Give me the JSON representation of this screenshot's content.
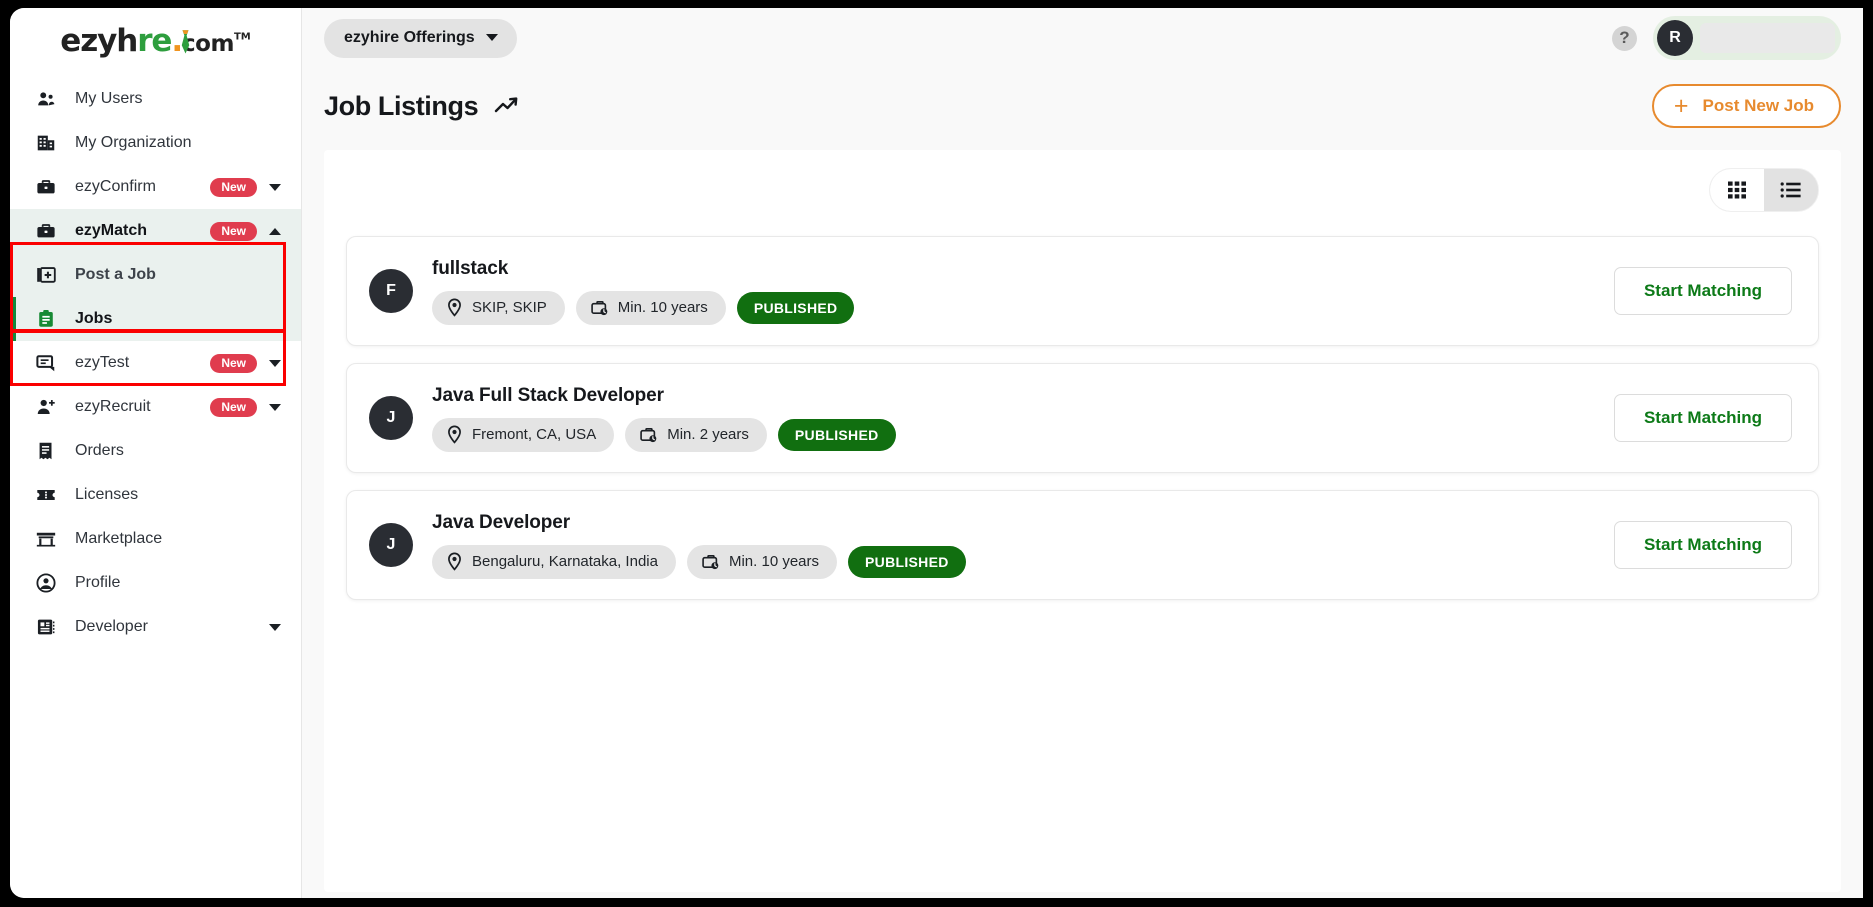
{
  "brand": {
    "logo_text_1": "ezyh",
    "logo_text_2": "re",
    "logo_dot": ".",
    "logo_com": "com",
    "logo_tm": "TM",
    "accent_green": "#2e9e3e",
    "accent_orange": "#f0941f"
  },
  "sidebar": {
    "items": [
      {
        "label": "My Users",
        "icon": "users-icon",
        "badge": "",
        "caret": "none",
        "state": "normal"
      },
      {
        "label": "My Organization",
        "icon": "building-icon",
        "badge": "",
        "caret": "none",
        "state": "normal"
      },
      {
        "label": "ezyConfirm",
        "icon": "briefcase-icon",
        "badge": "New",
        "caret": "down",
        "state": "normal"
      },
      {
        "label": "ezyMatch",
        "icon": "briefcase-icon",
        "badge": "New",
        "caret": "up",
        "state": "active"
      },
      {
        "label": "Post a Job",
        "icon": "post-job-icon",
        "badge": "",
        "caret": "none",
        "state": "sub"
      },
      {
        "label": "Jobs",
        "icon": "clipboard-icon",
        "badge": "",
        "caret": "none",
        "state": "current"
      },
      {
        "label": "ezyTest",
        "icon": "chat-icon",
        "badge": "New",
        "caret": "down",
        "state": "normal"
      },
      {
        "label": "ezyRecruit",
        "icon": "user-plus-icon",
        "badge": "New",
        "caret": "down",
        "state": "normal"
      },
      {
        "label": "Orders",
        "icon": "receipt-icon",
        "badge": "",
        "caret": "none",
        "state": "normal"
      },
      {
        "label": "Licenses",
        "icon": "ticket-icon",
        "badge": "",
        "caret": "none",
        "state": "normal"
      },
      {
        "label": "Marketplace",
        "icon": "store-icon",
        "badge": "",
        "caret": "none",
        "state": "normal"
      },
      {
        "label": "Profile",
        "icon": "profile-icon",
        "badge": "",
        "caret": "none",
        "state": "normal"
      },
      {
        "label": "Developer",
        "icon": "developer-icon",
        "badge": "",
        "caret": "down",
        "state": "normal"
      }
    ]
  },
  "topbar": {
    "offerings_label": "ezyhire Offerings",
    "help_glyph": "?",
    "avatar_initial": "R"
  },
  "page": {
    "title": "Job Listings",
    "post_new_job_label": "Post New Job",
    "plus_glyph": "+",
    "post_btn_color": "#e78a2e"
  },
  "view_toggle": {
    "grid_label": "grid-view",
    "list_label": "list-view",
    "selected": "list"
  },
  "jobs": [
    {
      "initial": "F",
      "title": "fullstack",
      "location": "SKIP, SKIP",
      "experience": "Min. 10 years",
      "status": "PUBLISHED",
      "action_label": "Start Matching"
    },
    {
      "initial": "J",
      "title": "Java Full Stack Developer",
      "location": "Fremont, CA, USA",
      "experience": "Min. 2 years",
      "status": "PUBLISHED",
      "action_label": "Start Matching"
    },
    {
      "initial": "J",
      "title": "Java Developer",
      "location": "Bengaluru, Karnataka, India",
      "experience": "Min. 10 years",
      "status": "PUBLISHED",
      "action_label": "Start Matching"
    }
  ],
  "annotations": {
    "highlight_color": "#fa0000",
    "boxes": [
      "ezymatch-post-a-job",
      "jobs",
      "start-matching-first-card"
    ]
  }
}
